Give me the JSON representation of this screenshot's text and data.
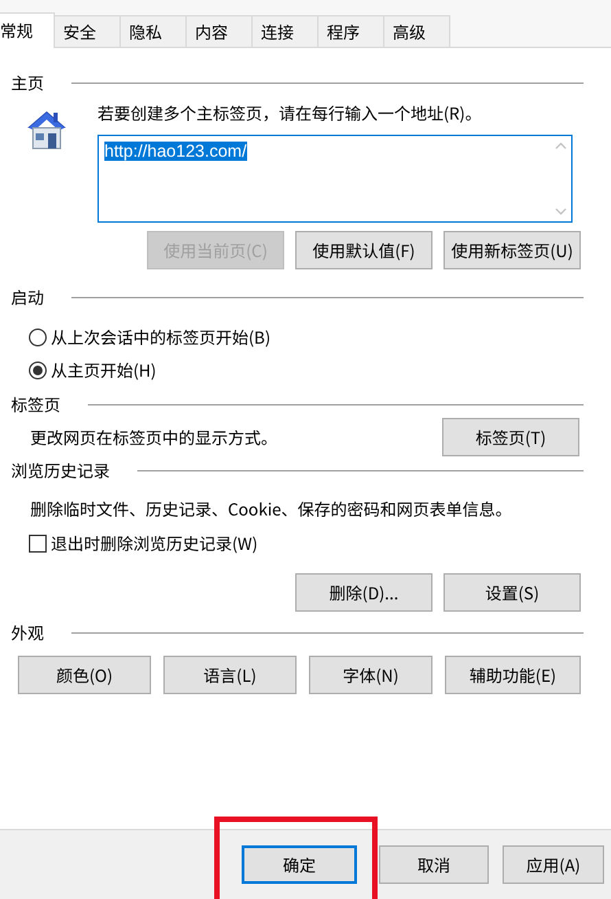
{
  "tabs": [
    {
      "label": "常规",
      "selected": true
    },
    {
      "label": "安全",
      "selected": false
    },
    {
      "label": "隐私",
      "selected": false
    },
    {
      "label": "内容",
      "selected": false
    },
    {
      "label": "连接",
      "selected": false
    },
    {
      "label": "程序",
      "selected": false
    },
    {
      "label": "高级",
      "selected": false
    }
  ],
  "home_page": {
    "heading": "主页",
    "instruction": "若要创建多个主标签页，请在每行输入一个地址(R)。",
    "value": "http://hao123.com/",
    "text_selected": true,
    "buttons": [
      {
        "label": "使用当前页(C)",
        "disabled": true
      },
      {
        "label": "使用默认值(F)",
        "disabled": false
      },
      {
        "label": "使用新标签页(U)",
        "disabled": false
      }
    ]
  },
  "startup": {
    "heading": "启动",
    "options": [
      {
        "label": "从上次会话中的标签页开始(B)",
        "selected": false
      },
      {
        "label": "从主页开始(H)",
        "selected": true
      }
    ]
  },
  "tabs_section": {
    "heading": "标签页",
    "description": "更改网页在标签页中的显示方式。",
    "button": "标签页(T)"
  },
  "browsing_history": {
    "heading": "浏览历史记录",
    "description": "删除临时文件、历史记录、Cookie、保存的密码和网页表单信息。",
    "checkbox": {
      "label": "退出时删除浏览历史记录(W)",
      "checked": false
    },
    "buttons": [
      "删除(D)...",
      "设置(S)"
    ]
  },
  "appearance": {
    "heading": "外观",
    "buttons": [
      "颜色(O)",
      "语言(L)",
      "字体(N)",
      "辅助功能(E)"
    ]
  },
  "footer_buttons": [
    {
      "label": "确定",
      "default": true,
      "highlighted": true
    },
    {
      "label": "取消",
      "default": false,
      "highlighted": false
    },
    {
      "label": "应用(A)",
      "default": false,
      "highlighted": false
    }
  ]
}
